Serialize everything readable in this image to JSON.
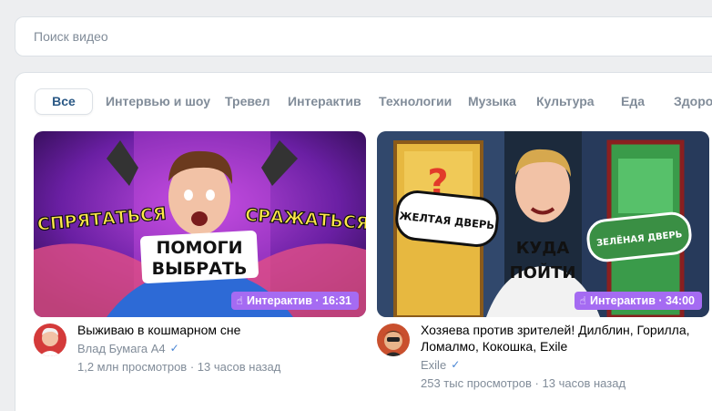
{
  "search": {
    "placeholder": "Поиск видео"
  },
  "tabs": [
    {
      "label": "Все",
      "active": true
    },
    {
      "label": "Интервью и шоу"
    },
    {
      "label": "Тревел"
    },
    {
      "label": "Интерактив"
    },
    {
      "label": "Технологии"
    },
    {
      "label": "Музыка"
    },
    {
      "label": "Культура"
    },
    {
      "label": "Еда"
    },
    {
      "label": "Здоровье"
    }
  ],
  "videos": [
    {
      "title": "Выживаю в кошмарном сне",
      "author": "Влад Бумага А4",
      "verified": true,
      "views": "1,2 млн просмотров",
      "sep": "·",
      "age": "13 часов назад",
      "badge": "Интерактив · 16:31",
      "thumb_text": {
        "left": "СПРЯТАТЬСЯ",
        "right": "СРАЖАТЬСЯ",
        "center_1": "ПОМОГИ",
        "center_2": "ВЫБРАТЬ"
      }
    },
    {
      "title": "Хозяева против зрителей! Дилблин, Горилла, Ломалмо, Кокошка, Exile",
      "author": "Exile",
      "verified": true,
      "views": "253 тыс просмотров",
      "sep": "·",
      "age": "13 часов назад",
      "badge": "Интерактив · 34:00",
      "thumb_text": {
        "left": "ЖЕЛТАЯ ДВЕРЬ",
        "right": "ЗЕЛЁНАЯ ДВЕРЬ",
        "center_1": "КУДА",
        "center_2": "ПОЙТИ"
      }
    }
  ],
  "colors": {
    "accent": "#2a5885",
    "badge": "#a56bf2",
    "muted": "#818c99",
    "verified": "#4a86d4"
  },
  "icons": {
    "badge_icon": "hand-pointer-icon",
    "verified_icon": "check-icon"
  }
}
